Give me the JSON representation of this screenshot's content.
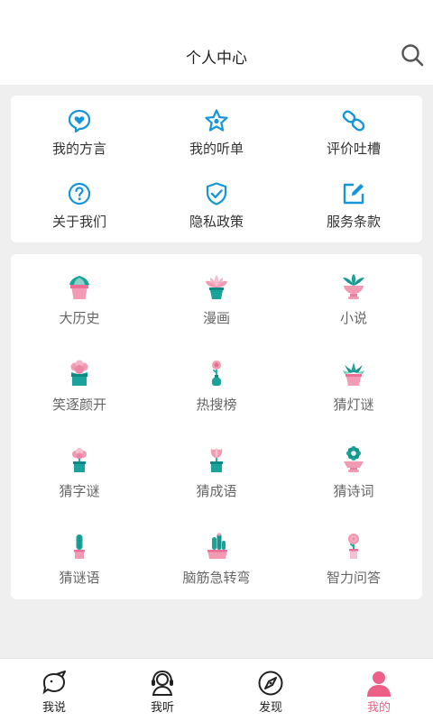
{
  "header": {
    "title": "个人中心"
  },
  "colors": {
    "accent": "#1596d8",
    "active_tab": "#ec5f86",
    "pink": "#f19ab2",
    "teal": "#1aa39a"
  },
  "menu": [
    {
      "label": "我的方言",
      "icon": "heart-bubble-icon"
    },
    {
      "label": "我的听单",
      "icon": "star-badge-icon"
    },
    {
      "label": "评价吐槽",
      "icon": "link-icon"
    },
    {
      "label": "关于我们",
      "icon": "question-icon"
    },
    {
      "label": "隐私政策",
      "icon": "shield-check-icon"
    },
    {
      "label": "服务条款",
      "icon": "edit-icon"
    }
  ],
  "categories": [
    {
      "label": "大历史",
      "icon": "succulent-pot-icon"
    },
    {
      "label": "漫画",
      "icon": "lotus-pot-icon"
    },
    {
      "label": "小说",
      "icon": "leaf-bowl-icon"
    },
    {
      "label": "笑逐颜开",
      "icon": "flower-pot-icon"
    },
    {
      "label": "热搜榜",
      "icon": "vase-flower-icon"
    },
    {
      "label": "猜灯谜",
      "icon": "agave-pot-icon"
    },
    {
      "label": "猜字谜",
      "icon": "sprout-pot-icon"
    },
    {
      "label": "猜成语",
      "icon": "tulip-pot-icon"
    },
    {
      "label": "猜诗词",
      "icon": "daisy-pot-icon"
    },
    {
      "label": "猜谜语",
      "icon": "cactus-pot-icon"
    },
    {
      "label": "脑筋急转弯",
      "icon": "cactus-planter-icon"
    },
    {
      "label": "智力问答",
      "icon": "rose-pot-icon"
    }
  ],
  "tabs": [
    {
      "label": "我说",
      "icon": "speech-bird-icon"
    },
    {
      "label": "我听",
      "icon": "headset-icon"
    },
    {
      "label": "发现",
      "icon": "compass-icon"
    },
    {
      "label": "我的",
      "icon": "person-icon",
      "active": true
    }
  ]
}
